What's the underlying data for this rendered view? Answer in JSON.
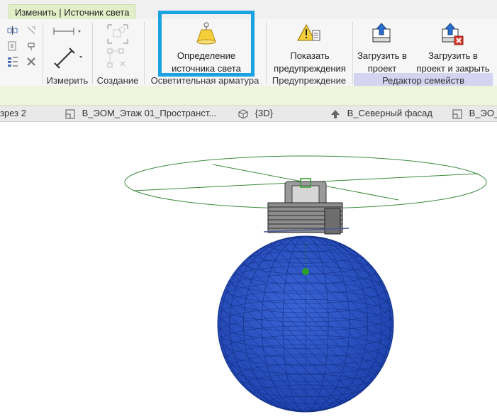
{
  "context_tab": {
    "label": "Изменить | Источник света"
  },
  "ribbon": {
    "panels": {
      "measure": "Измерить",
      "create": "Создание",
      "lighting_fixture": "Осветительная арматура",
      "warnings": "Предупреждение",
      "family_editor": "Редактор семейств"
    },
    "buttons": {
      "light_source": {
        "line1": "Определение",
        "line2": "источника света"
      },
      "show_warnings": {
        "line1": "Показать",
        "line2": "предупреждения"
      },
      "load_project": {
        "line1": "Загрузить в",
        "line2": "проект"
      },
      "load_close": {
        "line1": "Загрузить в",
        "line2": "проект и закрыть"
      }
    }
  },
  "view_tabs": [
    {
      "label": "зрез 2",
      "icon": "section-view-icon"
    },
    {
      "label": "В_ЭОМ_Этаж 01_Пространст...",
      "icon": "floor-plan-icon"
    },
    {
      "label": "{3D}",
      "icon": "3d-view-icon"
    },
    {
      "label": "В_Северный фасад",
      "icon": "elevation-icon"
    },
    {
      "label": "В_ЭО_Э",
      "icon": "floor-plan-icon"
    }
  ],
  "colors": {
    "highlight": "#1aa3e0",
    "sphere": "#2b55c9",
    "circle": "#3a8a3a",
    "context_tab": "#e3efc8",
    "editor_band": "#d4d4f0"
  }
}
